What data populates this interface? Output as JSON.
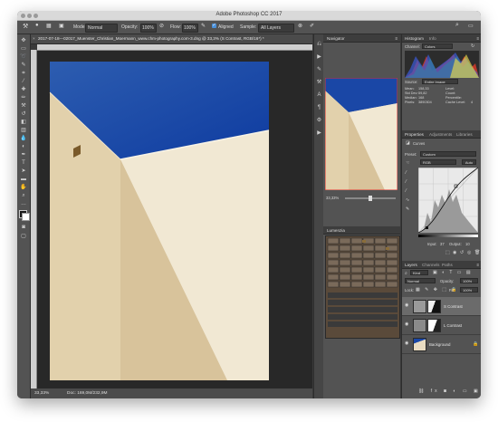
{
  "app": {
    "title": "Adobe Photoshop CC 2017",
    "accent": "#4a90d9"
  },
  "options_bar": {
    "mode_label": "Mode:",
    "mode_value": "Normal",
    "opacity_label": "Opacity:",
    "opacity_value": "100%",
    "flow_label": "Flow:",
    "flow_value": "100%",
    "aligned_label": "Aligned",
    "sample_label": "Sample:",
    "sample_value": "All Layers"
  },
  "document": {
    "tab_title": "2017-07-18---02017_Muenster_Christian_Moermann_www.chm-photography.com-3.dng @ 33,3% (S Contrast, RGB/16*) *",
    "zoom": "33,33%",
    "doc_info": "Doc: 169,0M/232,9M"
  },
  "navigator": {
    "title": "Navigator",
    "zoom": "33,33%"
  },
  "histogram": {
    "tabs": [
      "Histogram",
      "Info"
    ],
    "channel_label": "Channel:",
    "channel_value": "Colors",
    "source_label": "Source:",
    "source_value": "Entire Image",
    "stats": {
      "mean_label": "Mean:",
      "mean": "158,33",
      "std_label": "Std Dev:",
      "std": "59,82",
      "median_label": "Median:",
      "median": "168",
      "pixels_label": "Pixels:",
      "pixels": "3890304",
      "level_label": "Level:",
      "count_label": "Count:",
      "percentile_label": "Percentile:",
      "cache_label": "Cache Level:",
      "cache": "4"
    }
  },
  "properties": {
    "tabs": [
      "Properties",
      "Adjustments",
      "Libraries"
    ],
    "type": "Curves",
    "preset_label": "Preset:",
    "preset_value": "Custom",
    "channel_value": "RGB",
    "auto_label": "Auto",
    "input_label": "Input:",
    "input_value": "37",
    "output_label": "Output:",
    "output_value": "10"
  },
  "luminosity": {
    "title": "Lumenzia"
  },
  "layers": {
    "tabs": [
      "Layers",
      "Channels",
      "Paths"
    ],
    "kind_label": "Kind",
    "blend_value": "Normal",
    "opacity_label": "Opacity:",
    "opacity_value": "100%",
    "lock_label": "Lock:",
    "fill_label": "Fill:",
    "fill_value": "100%",
    "items": [
      {
        "name": "S Contrast"
      },
      {
        "name": "L Contrast"
      },
      {
        "name": "Background"
      }
    ]
  }
}
